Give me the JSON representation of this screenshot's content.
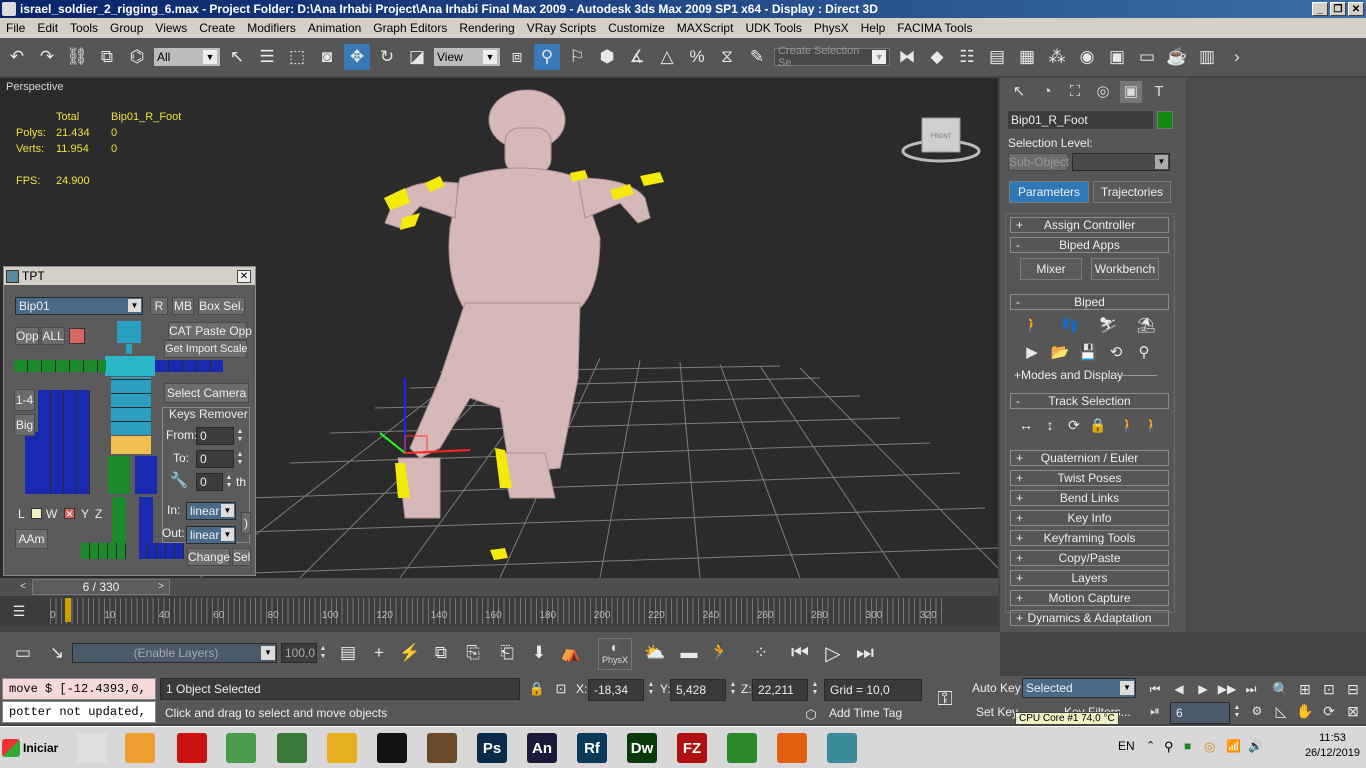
{
  "window": {
    "title": "israel_soldier_2_rigging_6.max    - Project Folder: D:\\Ana Irhabi Project\\Ana Irhabi Final Max 2009    - Autodesk 3ds Max  2009 SP1  x64     - Display : Direct 3D",
    "minimize": "_",
    "restore": "❐",
    "close": "✕"
  },
  "menu": [
    "File",
    "Edit",
    "Tools",
    "Group",
    "Views",
    "Create",
    "Modifiers",
    "Animation",
    "Graph Editors",
    "Rendering",
    "VRay Scripts",
    "Customize",
    "MAXScript",
    "UDK Tools",
    "PhysX",
    "Help",
    "FACIMA Tools"
  ],
  "toolbar": {
    "filter_value": "All",
    "refcoord_value": "View",
    "selection_set_placeholder": "Create Selection Se"
  },
  "viewport": {
    "label": "Perspective",
    "stats": {
      "col_total": "Total",
      "col_selected": "Bip01_R_Foot",
      "polys_label": "Polys:",
      "polys_total": "21.434",
      "polys_sel": "0",
      "verts_label": "Verts:",
      "verts_total": "11.954",
      "verts_sel": "0",
      "fps_label": "FPS:",
      "fps_value": "24.900"
    },
    "viewcube_label": "FRONT"
  },
  "tpt": {
    "title": "TPT",
    "close": "✕",
    "bip_value": "Bip01",
    "btn_r": "R",
    "btn_mb": "MB",
    "btn_boxsel": "Box Sel.",
    "btn_opp": "Opp",
    "btn_all": "ALL",
    "btn_catpaste": "CAT Paste Opp",
    "btn_getimport": "Get Import Scale",
    "btn_selectcam": "Select Camera",
    "keys_remover": "Keys Remover",
    "from_label": "From:",
    "from_value": "0",
    "to_label": "To:",
    "to_value": "0",
    "th_value": "0",
    "th_label": "th",
    "btn_14": "1-4",
    "btn_big": "Big",
    "chk_l": "L",
    "chk_w": "W",
    "chk_y": "Y",
    "chk_z": "Z",
    "btn_aam": "AAm",
    "in_label": "In:",
    "in_value": "linear",
    "out_label": "Out:",
    "out_value": "linear",
    "btn_changesel": "Change",
    "btn_sel": "Sel"
  },
  "timeline": {
    "frame_display": "6 / 330",
    "prev": "<",
    "next": ">",
    "tick_labels": [
      "0",
      "10",
      "40",
      "60",
      "80",
      "100",
      "120",
      "140",
      "160",
      "180",
      "200",
      "220",
      "240",
      "260",
      "280",
      "300",
      "320"
    ]
  },
  "bottom": {
    "layers_placeholder": "(Enable Layers)",
    "layer_value": "100,0",
    "physx_label": "PhysX",
    "listener_line1": "move $ [-12.4393,0,",
    "listener_line2": "potter not updated,",
    "status_selected": "1 Object Selected",
    "status_prompt": "Click and drag to select and move objects",
    "x_label": "X:",
    "x_value": "-18,34",
    "y_label": "Y:",
    "y_value": "5,428",
    "z_label": "Z:",
    "z_value": "22,211",
    "grid": "Grid = 10,0",
    "add_time_tag": "Add Time Tag",
    "auto_key": "Auto Key",
    "set_key": "Set Key",
    "key_mode_value": "Selected",
    "key_filters": "Key Filters...",
    "frame_field": "6"
  },
  "command_panel": {
    "object_name": "Bip01_R_Foot",
    "object_color": "#118811",
    "selection_level": "Selection Level:",
    "subobject": "Sub-Object",
    "tab_parameters": "Parameters",
    "tab_trajectories": "Trajectories",
    "rollouts": [
      {
        "sign": "+",
        "label": "Assign Controller"
      },
      {
        "sign": "-",
        "label": "Biped Apps"
      }
    ],
    "btn_mixer": "Mixer",
    "btn_workbench": "Workbench",
    "biped_rollout": {
      "sign": "-",
      "label": "Biped"
    },
    "modes_display": "+Modes and Display",
    "track_rollout": {
      "sign": "-",
      "label": "Track Selection"
    },
    "lower_rollouts": [
      {
        "sign": "+",
        "label": "Quaternion / Euler"
      },
      {
        "sign": "+",
        "label": "Twist Poses"
      },
      {
        "sign": "+",
        "label": "Bend Links"
      },
      {
        "sign": "+",
        "label": "Key Info"
      },
      {
        "sign": "+",
        "label": "Keyframing Tools"
      },
      {
        "sign": "+",
        "label": "Copy/Paste"
      },
      {
        "sign": "+",
        "label": "Layers"
      },
      {
        "sign": "+",
        "label": "Motion Capture"
      },
      {
        "sign": "+",
        "label": "Dynamics & Adaptation"
      }
    ]
  },
  "taskbar": {
    "start": "Iniciar",
    "apps": [
      {
        "name": "3ds-max-icon",
        "label": "",
        "color": "#e0e0e0"
      },
      {
        "name": "media-player-icon",
        "label": "",
        "color": "#f0a030"
      },
      {
        "name": "acrobat-icon",
        "label": "",
        "color": "#cc1111"
      },
      {
        "name": "task-manager-icon",
        "label": "",
        "color": "#4a9a4a"
      },
      {
        "name": "network-icon",
        "label": "",
        "color": "#3a7a3a"
      },
      {
        "name": "windows-explorer-icon",
        "label": "",
        "color": "#e8b020"
      },
      {
        "name": "unreal-icon",
        "label": "",
        "color": "#111111"
      },
      {
        "name": "rifle-icon",
        "label": "",
        "color": "#6a4a2a"
      },
      {
        "name": "photoshop-icon",
        "label": "Ps",
        "color": "#0b2a4a"
      },
      {
        "name": "animate-icon",
        "label": "An",
        "color": "#1a1a3a"
      },
      {
        "name": "robohelp-icon",
        "label": "Rf",
        "color": "#0a3a5a"
      },
      {
        "name": "dreamweaver-icon",
        "label": "Dw",
        "color": "#0a3a0a"
      },
      {
        "name": "filezilla-icon",
        "label": "FZ",
        "color": "#b01010"
      },
      {
        "name": "chrome-icon",
        "label": "",
        "color": "#2a8a2a"
      },
      {
        "name": "firefox-icon",
        "label": "",
        "color": "#e06010"
      },
      {
        "name": "3ds-max-active-icon",
        "label": "",
        "color": "#3a8a9a"
      }
    ],
    "lang": "EN",
    "time": "11:53",
    "date": "26/12/2019",
    "tooltip": "CPU Core #1  74,0 °C"
  }
}
